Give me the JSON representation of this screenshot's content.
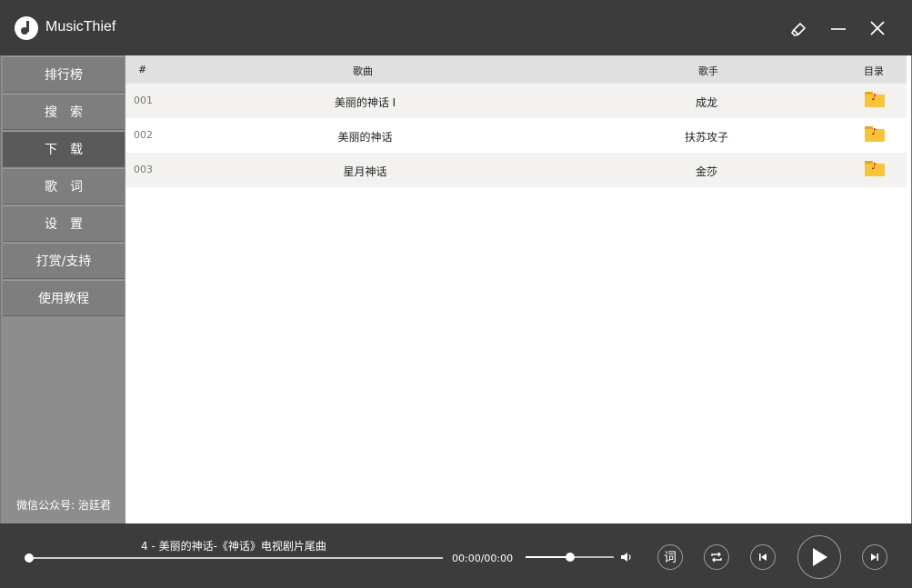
{
  "app": {
    "title": "MusicThief"
  },
  "sidebar": {
    "items": [
      {
        "label": "排行榜"
      },
      {
        "label": "搜　索"
      },
      {
        "label": "下　载"
      },
      {
        "label": "歌　词"
      },
      {
        "label": "设　置"
      },
      {
        "label": "打赏/支持"
      },
      {
        "label": "使用教程"
      }
    ],
    "active_index": 2,
    "footer": "微信公众号: 治廷君"
  },
  "table": {
    "headers": {
      "num": "#",
      "song": "歌曲",
      "singer": "歌手",
      "folder": "目录"
    },
    "rows": [
      {
        "num": "001",
        "song": "美丽的神话 I",
        "singer": "成龙",
        "folder_icon": "music-folder-icon"
      },
      {
        "num": "002",
        "song": "美丽的神话",
        "singer": "扶苏攻子",
        "folder_icon": "music-folder-icon"
      },
      {
        "num": "003",
        "song": "星月神话",
        "singer": "金莎",
        "folder_icon": "music-folder-icon"
      }
    ]
  },
  "player": {
    "now_playing": "4 - 美丽的神话-《神话》电视剧片尾曲",
    "time": "00:00/00:00",
    "progress": 0.0,
    "volume": 0.5,
    "lyric_label": "词"
  },
  "icons": {
    "skin": "brush-icon",
    "minimize": "minimize-icon",
    "close": "close-icon",
    "volume": "speaker-icon",
    "repeat": "repeat-icon",
    "prev": "skip-previous-icon",
    "play": "play-icon",
    "next": "skip-next-icon"
  },
  "colors": {
    "chrome": "#3c3c3c",
    "sidebar": "#8c8d8c",
    "nav_item": "#7d7e7d",
    "nav_active": "#5a5a5a",
    "folder": "#f7c43a"
  }
}
